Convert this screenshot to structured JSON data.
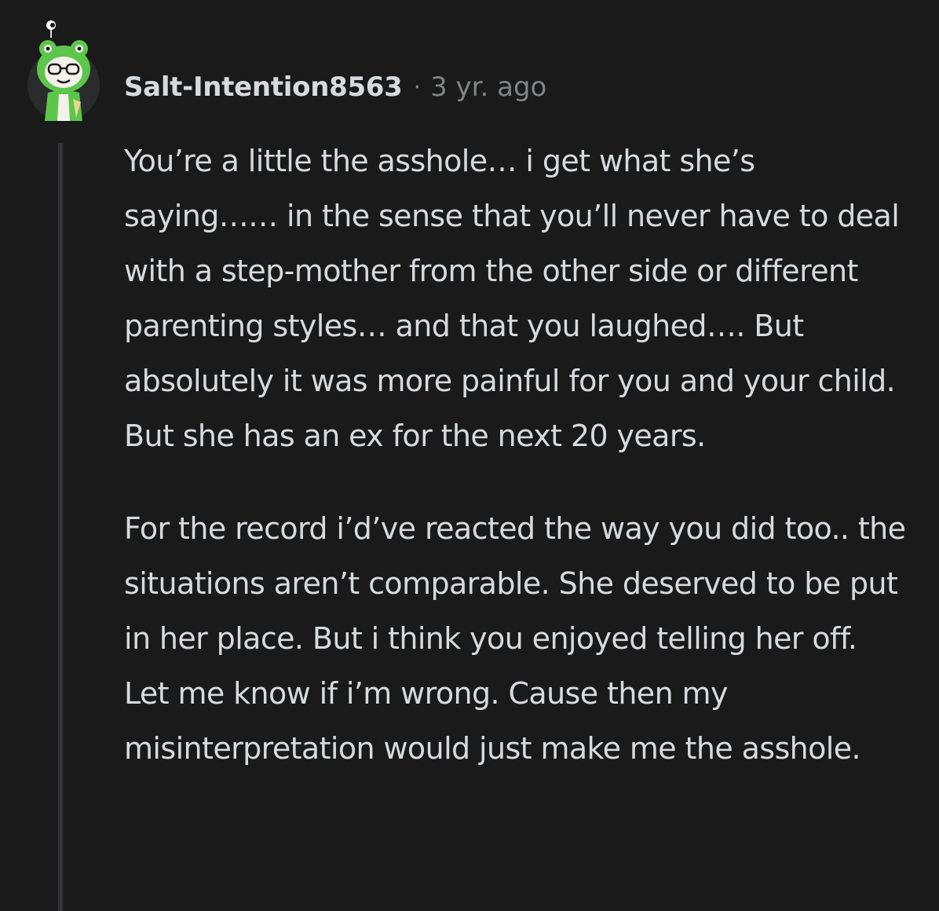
{
  "comment": {
    "author": "Salt-Intention8563",
    "separator": "·",
    "timestamp": "3 yr. ago",
    "avatar_icon": "frog-hood-avatar-icon",
    "paragraphs": [
      "You’re a little the asshole… i get what she’s saying…… in the sense that you’ll never have to deal with a step-mother from the other side or different parenting styles… and that you laughed…. But absolutely it was more painful for you and your child. But she has an ex for the next 20 years.",
      "For the record i’d’ve reacted the way you did too.. the situations aren’t comparable. She deserved to be put in her place. But i think you enjoyed telling her off. Let me know if i’m wrong. Cause then my misinterpretation would just make me the asshole."
    ]
  },
  "colors": {
    "background": "#1a1a1b",
    "text": "#d7dadc",
    "meta": "#818384",
    "thread_line": "#343536",
    "avatar_green": "#5cc64a"
  }
}
